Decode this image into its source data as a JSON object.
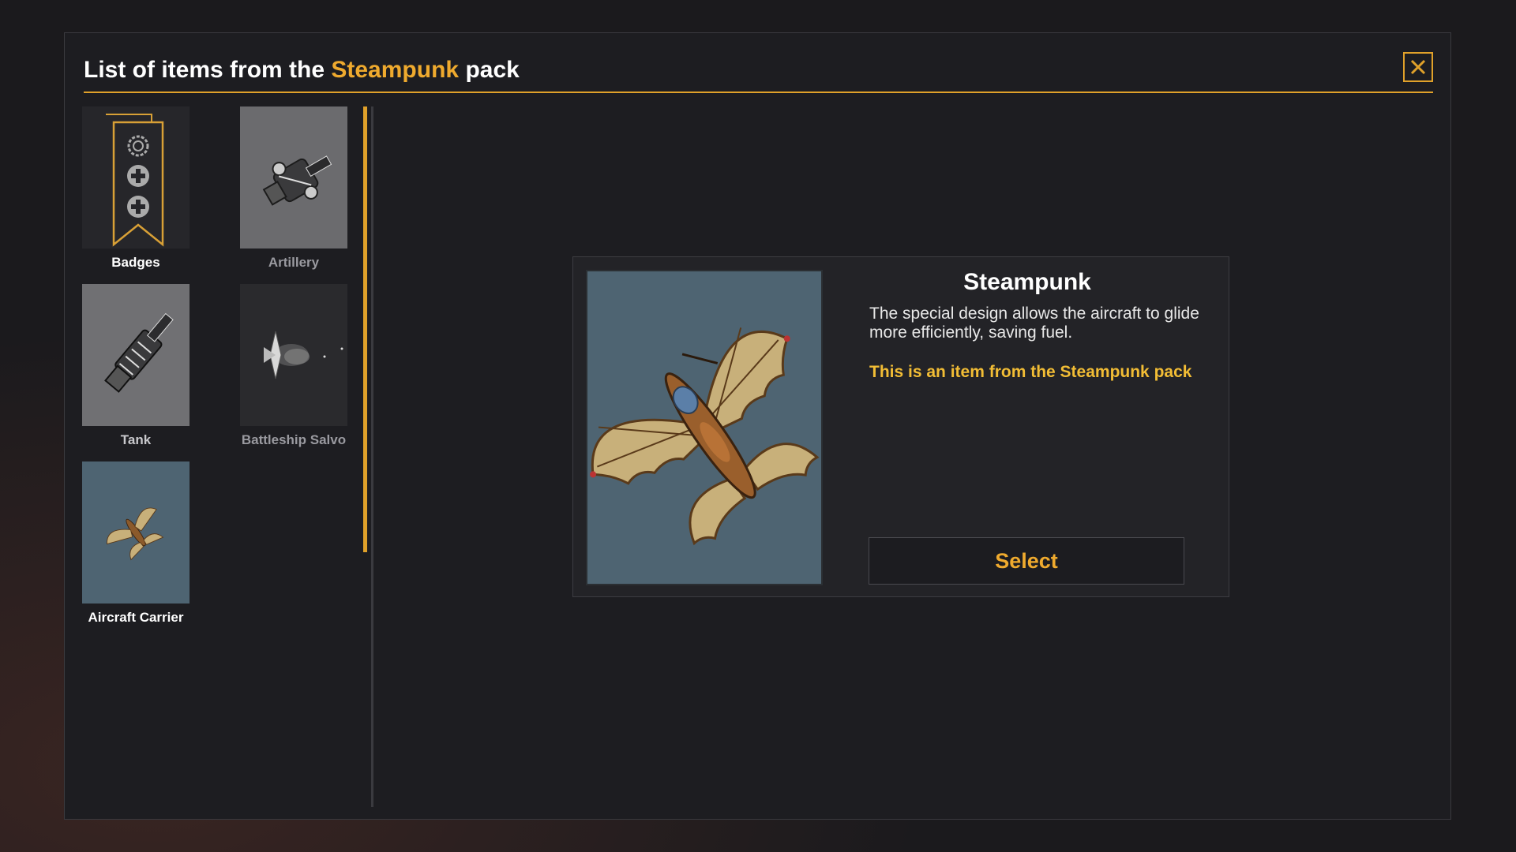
{
  "header": {
    "title_prefix": "List of items from the",
    "title_pack": "Steampunk",
    "title_suffix": "pack"
  },
  "items": [
    {
      "label": "Badges",
      "icon": "badges-ribbon-icon",
      "state": "bright"
    },
    {
      "label": "Artillery",
      "icon": "artillery-icon",
      "state": "dim"
    },
    {
      "label": "Tank",
      "icon": "tank-icon",
      "state": "bright"
    },
    {
      "label": "Battleship Salvo",
      "icon": "battleship-salvo-icon",
      "state": "dim"
    },
    {
      "label": "Aircraft Carrier",
      "icon": "steampunk-aircraft-icon",
      "state": "selected"
    }
  ],
  "detail": {
    "name": "Steampunk",
    "description": "The special design allows the aircraft to glide more efficiently, saving fuel.",
    "pack_note": "This is an item from the Steampunk pack",
    "select_label": "Select"
  },
  "colors": {
    "accent": "#efaa2e",
    "pack_note": "#f2bd35",
    "selected_tile": "#4e6472",
    "panel": "#1d1d21"
  }
}
